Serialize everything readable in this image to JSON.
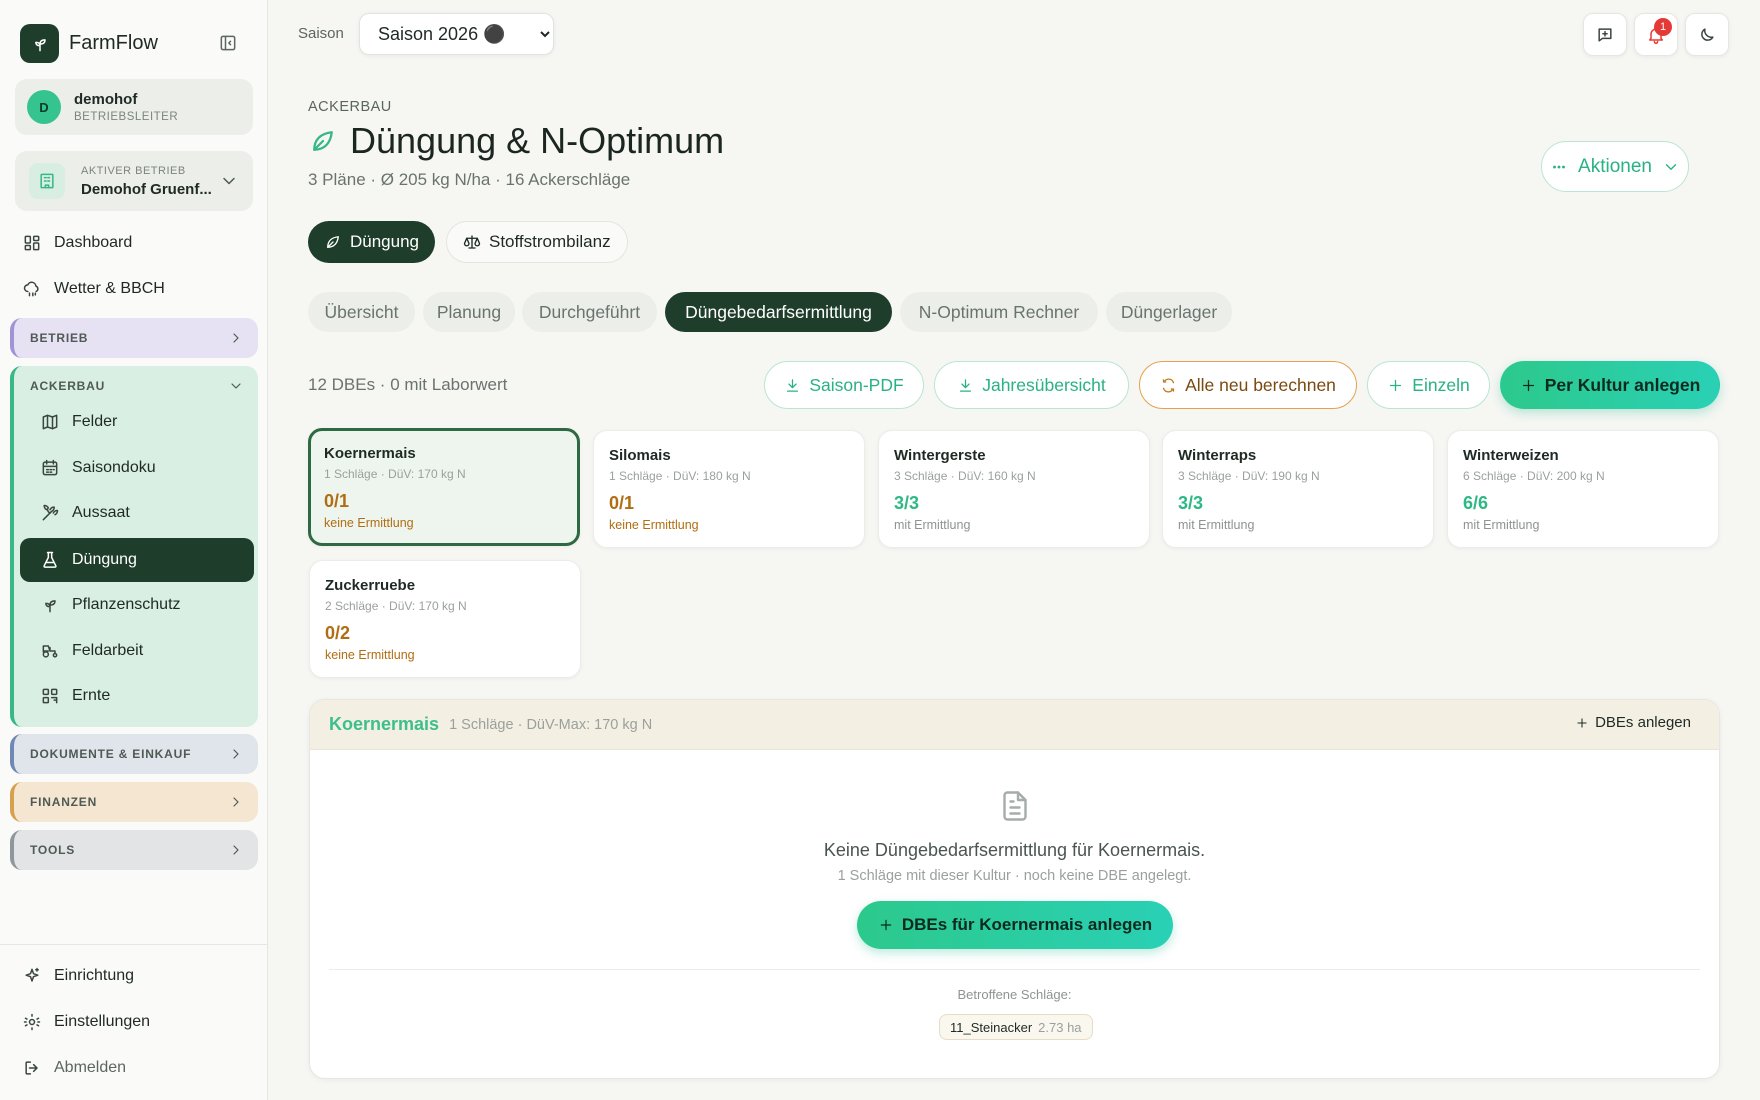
{
  "app": {
    "name": "FarmFlow"
  },
  "user": {
    "initial": "D",
    "name": "demohof",
    "role": "BETRIEBSLEITER"
  },
  "company": {
    "label": "AKTIVER BETRIEB",
    "name": "Demohof Gruenf..."
  },
  "nav": {
    "dashboard": "Dashboard",
    "weather": "Wetter & BBCH"
  },
  "groups": {
    "betrieb": "BETRIEB",
    "ackerbau": "ACKERBAU",
    "dokumente": "DOKUMENTE & EINKAUF",
    "finanzen": "FINANZEN",
    "tools": "TOOLS"
  },
  "ackerbau_items": [
    "Felder",
    "Saisondoku",
    "Aussaat",
    "Düngung",
    "Pflanzenschutz",
    "Feldarbeit",
    "Ernte"
  ],
  "bottom_nav": {
    "setup": "Einrichtung",
    "settings": "Einstellungen",
    "logout": "Abmelden"
  },
  "topbar": {
    "season_label": "Saison",
    "season_value": "Saison 2026 ⚫",
    "notification_count": "1"
  },
  "header": {
    "section": "ACKERBAU",
    "title": "Düngung & N-Optimum",
    "subtitle": "3 Pläne · Ø 205 kg N/ha · 16 Ackerschläge",
    "actions": "Aktionen"
  },
  "main_tabs": {
    "duengung": "Düngung",
    "stoffstrom": "Stoffstrombilanz"
  },
  "sub_tabs": [
    "Übersicht",
    "Planung",
    "Durchgeführt",
    "Düngebedarfsermittlung",
    "N-Optimum Rechner",
    "Düngerlager"
  ],
  "toolbar": {
    "count": "12 DBEs · 0 mit Laborwert",
    "saison_pdf": "Saison-PDF",
    "jahres": "Jahresübersicht",
    "recalc": "Alle neu berechnen",
    "single": "Einzeln",
    "per_crop": "Per Kultur anlegen"
  },
  "crops": [
    {
      "name": "Koernermais",
      "meta": "1 Schläge · DüV: 170 kg N",
      "ratio": "0/1",
      "status": "keine Ermittlung"
    },
    {
      "name": "Silomais",
      "meta": "1 Schläge · DüV: 180 kg N",
      "ratio": "0/1",
      "status": "keine Ermittlung"
    },
    {
      "name": "Wintergerste",
      "meta": "3 Schläge · DüV: 160 kg N",
      "ratio": "3/3",
      "status": "mit Ermittlung"
    },
    {
      "name": "Winterraps",
      "meta": "3 Schläge · DüV: 190 kg N",
      "ratio": "3/3",
      "status": "mit Ermittlung"
    },
    {
      "name": "Winterweizen",
      "meta": "6 Schläge · DüV: 200 kg N",
      "ratio": "6/6",
      "status": "mit Ermittlung"
    },
    {
      "name": "Zuckerruebe",
      "meta": "2 Schläge · DüV: 170 kg N",
      "ratio": "0/2",
      "status": "keine Ermittlung"
    }
  ],
  "detail": {
    "crop": "Koernermais",
    "meta": "1 Schläge · DüV-Max: 170 kg N",
    "add": "DBEs anlegen",
    "empty_title": "Keine Düngebedarfsermittlung für Koernermais.",
    "empty_sub": "1 Schläge mit dieser Kultur · noch keine DBE angelegt.",
    "cta": "DBEs für Koernermais anlegen",
    "affected_label": "Betroffene Schläge:",
    "field_name": "11_Steinacker",
    "field_ha": "2.73 ha"
  },
  "colors": {
    "brand_dark": "#1f3d2b",
    "accent": "#2cc98c",
    "warning": "#b06e12"
  }
}
